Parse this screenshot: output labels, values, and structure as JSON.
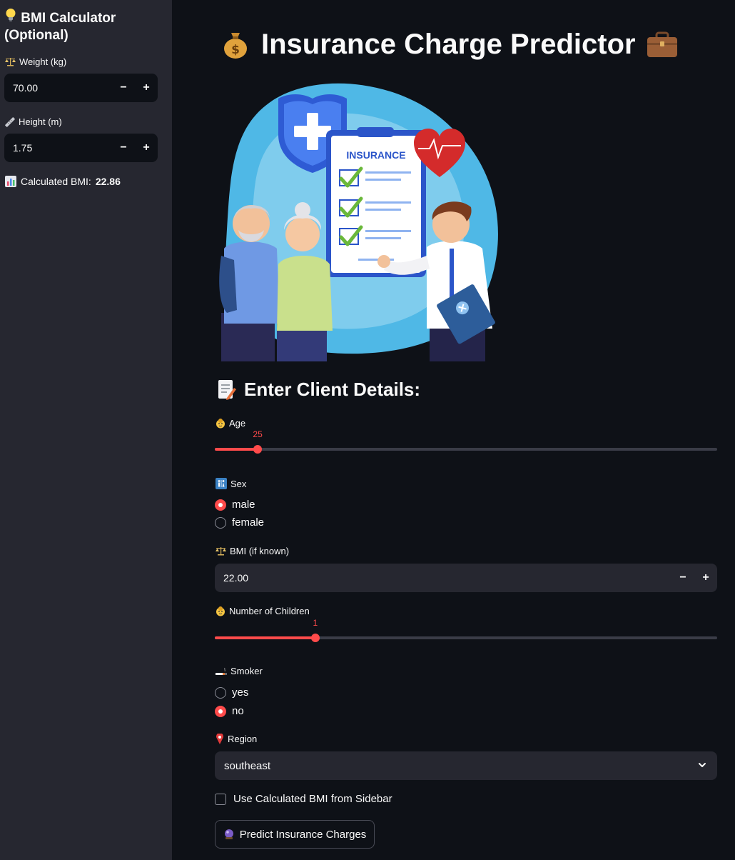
{
  "sidebar": {
    "title": "BMI Calculator (Optional)",
    "weight": {
      "label": "Weight (kg)",
      "value": "70.00"
    },
    "height": {
      "label": "Height (m)",
      "value": "1.75"
    },
    "bmi": {
      "label": "Calculated BMI:",
      "value": "22.86"
    }
  },
  "main": {
    "title": "Insurance Charge Predictor",
    "hero_image": {
      "clipboard_text": "INSURANCE"
    },
    "section_heading": "Enter Client Details:",
    "age": {
      "label": "Age",
      "value": 25,
      "min": 18,
      "max": 100
    },
    "sex": {
      "label": "Sex",
      "options": [
        "male",
        "female"
      ],
      "selected": "male"
    },
    "bmi_input": {
      "label": "BMI (if known)",
      "value": "22.00"
    },
    "children": {
      "label": "Number of Children",
      "value": 1,
      "min": 0,
      "max": 5
    },
    "smoker": {
      "label": "Smoker",
      "options": [
        "yes",
        "no"
      ],
      "selected": "no"
    },
    "region": {
      "label": "Region",
      "value": "southeast"
    },
    "use_sidebar_bmi": {
      "label": "Use Calculated BMI from Sidebar",
      "checked": false
    },
    "predict_button": "Predict Insurance Charges"
  },
  "colors": {
    "accent": "#ff4b4b",
    "background": "#0e1117",
    "sidebar_bg": "#262730",
    "widget_bg": "#262730"
  },
  "icons": {
    "sidebar_title": "light-bulb-icon",
    "weight": "balance-scale-icon",
    "height": "ruler-icon",
    "bmi": "bar-chart-icon",
    "title_left": "money-bag-icon",
    "title_right": "briefcase-icon",
    "section": "memo-icon",
    "age": "baby-face-icon",
    "sex": "restroom-icon",
    "bmi_input": "balance-scale-icon",
    "children": "baby-face-icon",
    "smoker": "cigarette-icon",
    "region": "location-pin-icon",
    "predict": "crystal-ball-icon"
  }
}
